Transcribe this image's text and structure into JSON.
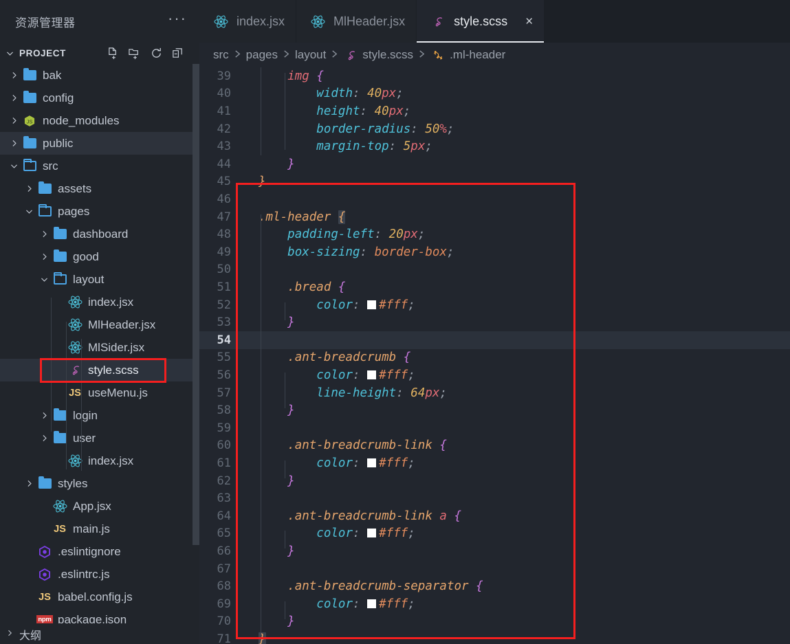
{
  "sidebar": {
    "title": "资源管理器",
    "more_label": "···",
    "section": {
      "label": "PROJECT",
      "chevron": "chevron-down",
      "actions": [
        {
          "name": "new-file-icon",
          "label": "新建文件"
        },
        {
          "name": "new-folder-icon",
          "label": "新建文件夹"
        },
        {
          "name": "refresh-icon",
          "label": "刷新资源管理器"
        },
        {
          "name": "collapse-all-icon",
          "label": "在资源管理器中折叠文件夹"
        }
      ]
    },
    "tree": [
      {
        "label": "bak",
        "depth": 0,
        "kind": "folder",
        "state": "collapsed",
        "icon": "folder-icon"
      },
      {
        "label": "config",
        "depth": 0,
        "kind": "folder",
        "state": "collapsed",
        "icon": "folder-icon"
      },
      {
        "label": "node_modules",
        "depth": 0,
        "kind": "folder",
        "state": "collapsed",
        "icon": "nodejs-icon"
      },
      {
        "label": "public",
        "depth": 0,
        "kind": "folder",
        "state": "collapsed",
        "icon": "folder-icon",
        "hovered": true
      },
      {
        "label": "src",
        "depth": 0,
        "kind": "folder",
        "state": "expanded",
        "icon": "folder-open-icon"
      },
      {
        "label": "assets",
        "depth": 1,
        "kind": "folder",
        "state": "collapsed",
        "icon": "folder-icon"
      },
      {
        "label": "pages",
        "depth": 1,
        "kind": "folder",
        "state": "expanded",
        "icon": "folder-open-icon"
      },
      {
        "label": "dashboard",
        "depth": 2,
        "kind": "folder",
        "state": "collapsed",
        "icon": "folder-icon"
      },
      {
        "label": "good",
        "depth": 2,
        "kind": "folder",
        "state": "collapsed",
        "icon": "folder-icon"
      },
      {
        "label": "layout",
        "depth": 2,
        "kind": "folder",
        "state": "expanded",
        "icon": "folder-open-icon"
      },
      {
        "label": "index.jsx",
        "depth": 3,
        "kind": "file",
        "icon": "react-icon"
      },
      {
        "label": "MlHeader.jsx",
        "depth": 3,
        "kind": "file",
        "icon": "react-icon"
      },
      {
        "label": "MlSider.jsx",
        "depth": 3,
        "kind": "file",
        "icon": "react-icon"
      },
      {
        "label": "style.scss",
        "depth": 3,
        "kind": "file",
        "icon": "sass-icon",
        "selected": true,
        "annotated": true
      },
      {
        "label": "useMenu.js",
        "depth": 3,
        "kind": "file",
        "icon": "js-icon"
      },
      {
        "label": "login",
        "depth": 2,
        "kind": "folder",
        "state": "collapsed",
        "icon": "folder-icon"
      },
      {
        "label": "user",
        "depth": 2,
        "kind": "folder",
        "state": "collapsed",
        "icon": "folder-icon"
      },
      {
        "label": "index.jsx",
        "depth": 3,
        "kind": "file",
        "icon": "react-icon"
      },
      {
        "label": "styles",
        "depth": 1,
        "kind": "folder",
        "state": "collapsed",
        "icon": "folder-icon"
      },
      {
        "label": "App.jsx",
        "depth": 2,
        "kind": "file",
        "icon": "react-icon"
      },
      {
        "label": "main.js",
        "depth": 2,
        "kind": "file",
        "icon": "js-icon"
      },
      {
        "label": ".eslintignore",
        "depth": 1,
        "kind": "file",
        "icon": "eslint-icon"
      },
      {
        "label": ".eslintrc.js",
        "depth": 1,
        "kind": "file",
        "icon": "eslint-icon"
      },
      {
        "label": "babel.config.js",
        "depth": 1,
        "kind": "file",
        "icon": "js-icon"
      },
      {
        "label": "package.json",
        "depth": 1,
        "kind": "file",
        "icon": "npm-icon"
      }
    ],
    "outline_label": "大纲"
  },
  "tabs": [
    {
      "label": "index.jsx",
      "icon": "react-icon",
      "active": false,
      "closable": false
    },
    {
      "label": "MlHeader.jsx",
      "icon": "react-icon",
      "active": false,
      "closable": false
    },
    {
      "label": "style.scss",
      "icon": "sass-icon",
      "active": true,
      "closable": true,
      "close_label": "×"
    }
  ],
  "breadcrumb": {
    "items": [
      {
        "label": "src",
        "icon": null
      },
      {
        "label": "pages",
        "icon": null
      },
      {
        "label": "layout",
        "icon": null
      },
      {
        "label": "style.scss",
        "icon": "sass-icon"
      },
      {
        "label": ".ml-header",
        "icon": "css-rule-icon"
      }
    ],
    "separator": "❯"
  },
  "editor": {
    "language": "scss",
    "active_line": 54,
    "first_visible_line": 39,
    "last_visible_line": 71,
    "bracket_match_lines": [
      47,
      71
    ],
    "code_lines": [
      {
        "n": 39,
        "text": "    img {"
      },
      {
        "n": 40,
        "text": "        width: 40px;"
      },
      {
        "n": 41,
        "text": "        height: 40px;"
      },
      {
        "n": 42,
        "text": "        border-radius: 50%;"
      },
      {
        "n": 43,
        "text": "        margin-top: 5px;"
      },
      {
        "n": 44,
        "text": "    }"
      },
      {
        "n": 45,
        "text": "}"
      },
      {
        "n": 46,
        "text": ""
      },
      {
        "n": 47,
        "text": ".ml-header {"
      },
      {
        "n": 48,
        "text": "    padding-left: 20px;"
      },
      {
        "n": 49,
        "text": "    box-sizing: border-box;"
      },
      {
        "n": 50,
        "text": ""
      },
      {
        "n": 51,
        "text": "    .bread {"
      },
      {
        "n": 52,
        "text": "        color: #fff;"
      },
      {
        "n": 53,
        "text": "    }"
      },
      {
        "n": 54,
        "text": ""
      },
      {
        "n": 55,
        "text": "    .ant-breadcrumb {"
      },
      {
        "n": 56,
        "text": "        color: #fff;"
      },
      {
        "n": 57,
        "text": "        line-height: 64px;"
      },
      {
        "n": 58,
        "text": "    }"
      },
      {
        "n": 59,
        "text": ""
      },
      {
        "n": 60,
        "text": "    .ant-breadcrumb-link {"
      },
      {
        "n": 61,
        "text": "        color: #fff;"
      },
      {
        "n": 62,
        "text": "    }"
      },
      {
        "n": 63,
        "text": ""
      },
      {
        "n": 64,
        "text": "    .ant-breadcrumb-link a {"
      },
      {
        "n": 65,
        "text": "        color: #fff;"
      },
      {
        "n": 66,
        "text": "    }"
      },
      {
        "n": 67,
        "text": ""
      },
      {
        "n": 68,
        "text": "    .ant-breadcrumb-separator {"
      },
      {
        "n": 69,
        "text": "        color: #fff;"
      },
      {
        "n": 70,
        "text": "    }"
      },
      {
        "n": 71,
        "text": "}"
      }
    ]
  },
  "annotations": [
    {
      "name": "sidebar-style-scss-highlight",
      "color": "#f41f1f"
    },
    {
      "name": "code-ml-header-rule-highlight",
      "color": "#f41f1f"
    }
  ],
  "colors": {
    "accent_red": "#f41f1f",
    "folder_blue": "#4ba3e3",
    "sass_pink": "#cd6799",
    "react_cyan": "#61dafb",
    "js_yellow": "#f5c96b",
    "npm_red": "#cb3837",
    "eslint_purple": "#7b3fe4",
    "editor_bg": "#22262e",
    "sidebar_bg": "#21252b"
  }
}
